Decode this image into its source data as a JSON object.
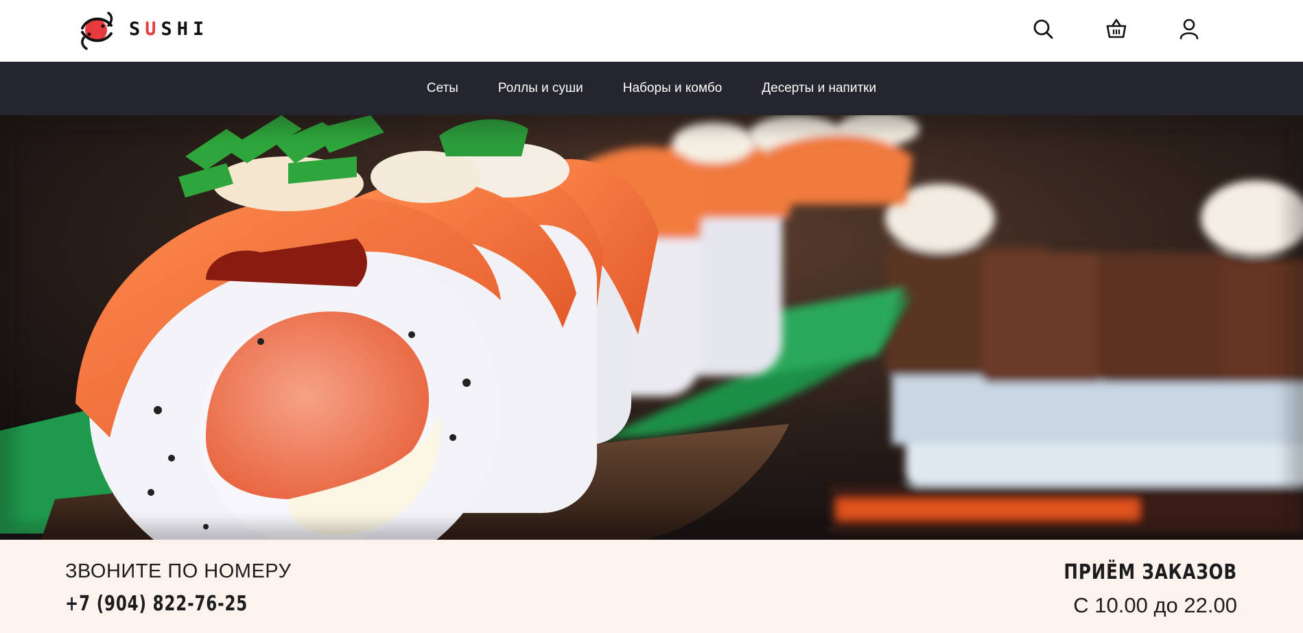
{
  "header": {
    "logo": {
      "text_start": "S",
      "text_accent": "U",
      "text_end": "SHI",
      "accent_color": "#e63a3c"
    },
    "icons": [
      "search-icon",
      "basket-icon",
      "user-icon"
    ]
  },
  "nav": {
    "items": [
      {
        "label": "Сеты"
      },
      {
        "label": "Роллы и суши"
      },
      {
        "label": "Наборы и комбо"
      },
      {
        "label": "Десерты и напитки"
      }
    ]
  },
  "contacts": {
    "call_label": "ЗВОНИТЕ ПО НОМЕРУ",
    "phone": "+7 (904) 822-76-25",
    "orders_label": "ПРИЁМ ЗАКАЗОВ",
    "orders_hours": "С 10.00 до 22.00"
  },
  "colors": {
    "nav_bg": "#25252f",
    "info_bg": "#fdf3ee",
    "brand_red": "#e63a3c"
  }
}
